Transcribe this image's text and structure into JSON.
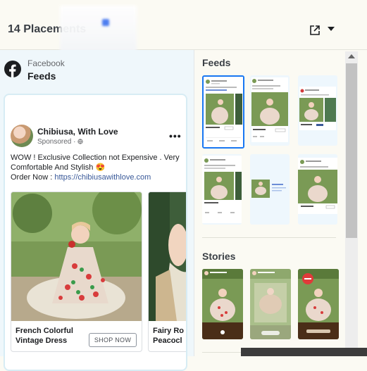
{
  "header": {
    "title": "14 Placements"
  },
  "preview": {
    "platform": "Facebook",
    "placement": "Feeds",
    "page_name": "Chibiusa, With Love",
    "sponsored": "Sponsored",
    "privacy_icon": "globe-icon",
    "menu_icon": "more-options-icon",
    "menu_symbol": "•••",
    "primary_text_line1": "WOW ! Exclusive Collection not Expensive . Very Comfortable And Stylish 😍",
    "primary_text_order": "Order Now : ",
    "link": "https://chibiusawithlove.com",
    "carousel": [
      {
        "title_line1": "French Colorful",
        "title_line2": "Vintage Dress",
        "cta": "SHOP NOW"
      },
      {
        "title_line1": "Fairy Ro",
        "title_line2": "Peacocl"
      }
    ]
  },
  "placements": {
    "feeds_title": "Feeds",
    "stories_title": "Stories"
  },
  "colors": {
    "accent": "#1877f2",
    "facebook": "#1c1e21",
    "link": "#385898"
  }
}
